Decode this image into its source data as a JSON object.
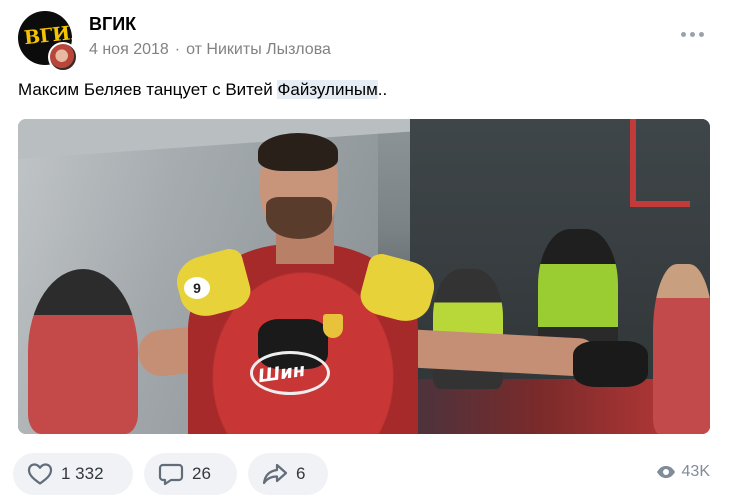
{
  "post": {
    "group_name": "ВГИК",
    "avatar_text": "ВГИК",
    "date": "4 ноя 2018",
    "separator": "·",
    "author": "от Никиты Лызлова",
    "text_prefix": "Максим Беляев танцует с Витей ",
    "text_highlight": "Файзулиным",
    "text_suffix": ".."
  },
  "media": {
    "sponsor_text": "Шин",
    "shirt_number": "9"
  },
  "footer": {
    "likes": "1 332",
    "comments": "26",
    "shares": "6",
    "views": "43K"
  },
  "icons": {
    "like": "heart-icon",
    "comment": "comment-icon",
    "share": "share-icon",
    "views": "eye-icon",
    "more": "more-dots-icon"
  },
  "colors": {
    "secondary_text": "#828282",
    "action_bg": "#f0f2f5",
    "icon": "#818c99",
    "highlight": "#e6ecf4"
  }
}
